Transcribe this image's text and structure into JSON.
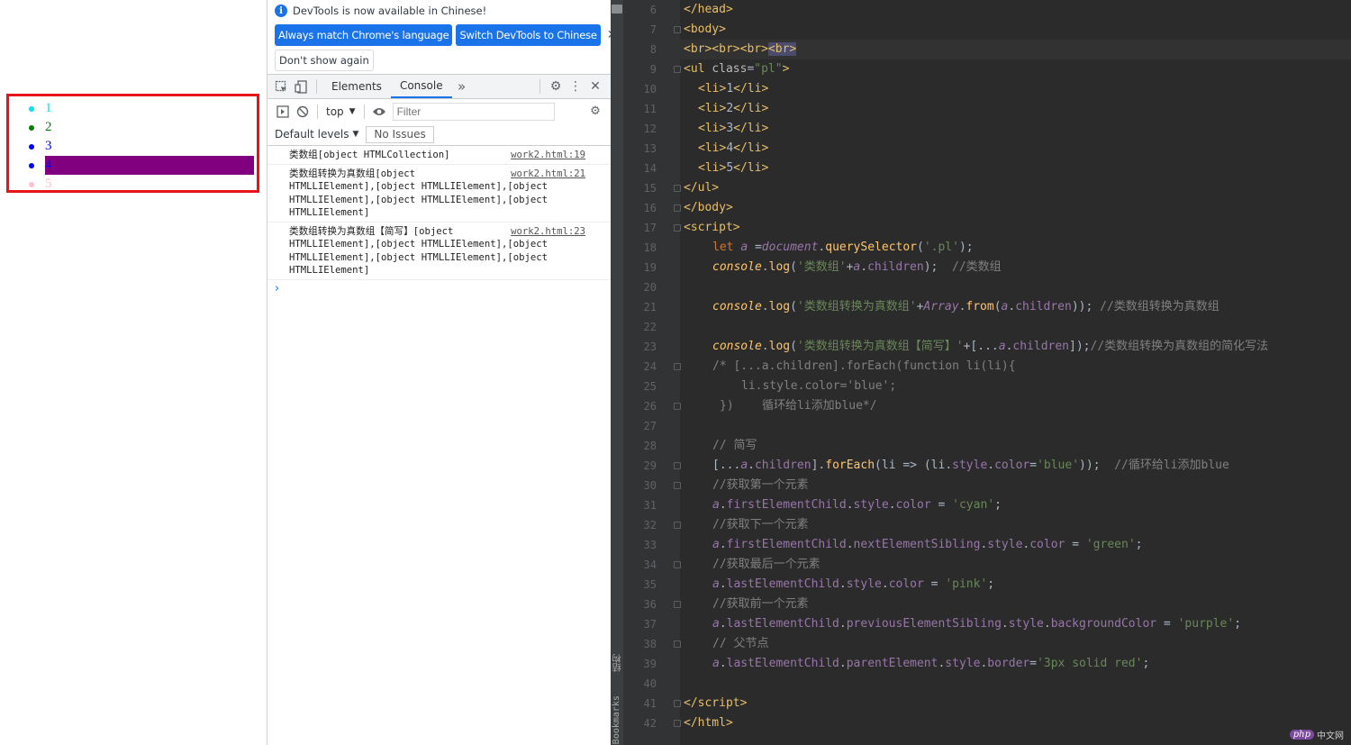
{
  "preview": {
    "list_items": [
      {
        "text": "1",
        "color": "#00e5e5",
        "bg": ""
      },
      {
        "text": "2",
        "color": "#008000",
        "bg": ""
      },
      {
        "text": "3",
        "color": "#0000ff",
        "bg": ""
      },
      {
        "text": "4",
        "color": "#0000ff",
        "bg": "#800080"
      },
      {
        "text": "5",
        "color": "#ffc0cb",
        "bg": ""
      }
    ],
    "border_color": "#e8141c"
  },
  "devtools": {
    "info_text": "DevTools is now available in Chinese!",
    "btn_match": "Always match Chrome's language",
    "btn_switch": "Switch DevTools to Chinese",
    "btn_dont_show": "Don't show again",
    "tab_elements": "Elements",
    "tab_console": "Console",
    "context_select": "top",
    "filter_placeholder": "Filter",
    "default_levels": "Default levels",
    "no_issues": "No Issues",
    "messages": [
      {
        "text": "类数组[object HTMLCollection]",
        "src": "work2.html:19"
      },
      {
        "text": "类数组转换为真数组[object\nHTMLLIElement],[object HTMLLIElement],[object\nHTMLLIElement],[object HTMLLIElement],[object\nHTMLLIElement]",
        "src": "work2.html:21"
      },
      {
        "text": "类数组转换为真数组【简写】[object\nHTMLLIElement],[object HTMLLIElement],[object\nHTMLLIElement],[object HTMLLIElement],[object\nHTMLLIElement]",
        "src": "work2.html:23"
      }
    ],
    "prompt": "›"
  },
  "editor": {
    "side_label_1": "结构",
    "side_label_2": "Bookmarks",
    "line_numbers": [
      "6",
      "7",
      "8",
      "9",
      "10",
      "11",
      "12",
      "13",
      "14",
      "15",
      "16",
      "17",
      "18",
      "19",
      "20",
      "21",
      "22",
      "23",
      "24",
      "25",
      "26",
      "27",
      "28",
      "29",
      "30",
      "31",
      "32",
      "33",
      "34",
      "35",
      "36",
      "37",
      "38",
      "39",
      "40",
      "41",
      "42"
    ],
    "watermark": "中文网",
    "watermark_logo": "php"
  }
}
